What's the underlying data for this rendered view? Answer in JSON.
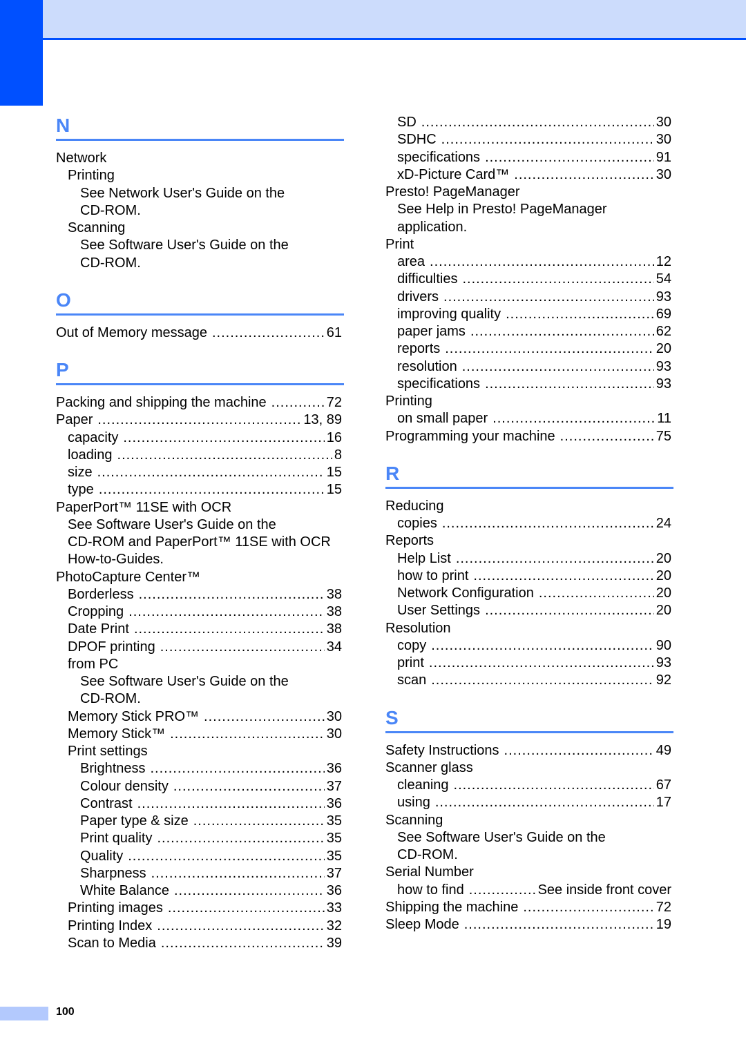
{
  "header": {
    "accent_color": "#0050ff",
    "band_color": "#ccdcfc",
    "letter_color": "#4a86f7"
  },
  "columns": [
    {
      "id": "left",
      "sections": [
        {
          "letter": "N",
          "entries": [
            {
              "level": 0,
              "term": "Network"
            },
            {
              "level": 1,
              "term": "Printing"
            },
            {
              "level": 2,
              "term": "See Network User's Guide on the"
            },
            {
              "level": 2,
              "term": "CD-ROM."
            },
            {
              "level": 1,
              "term": "Scanning"
            },
            {
              "level": 2,
              "term": "See Software User's Guide on the"
            },
            {
              "level": 2,
              "term": "CD-ROM."
            }
          ]
        },
        {
          "letter": "O",
          "entries": [
            {
              "level": 0,
              "term": "Out of Memory message",
              "page": "61"
            }
          ]
        },
        {
          "letter": "P",
          "entries": [
            {
              "level": 0,
              "term": "Packing and shipping the machine",
              "page": "72"
            },
            {
              "level": 0,
              "term": "Paper",
              "page": "13, 89"
            },
            {
              "level": 1,
              "term": "capacity",
              "page": "16"
            },
            {
              "level": 1,
              "term": "loading",
              "page": "8"
            },
            {
              "level": 1,
              "term": "size",
              "page": "15"
            },
            {
              "level": 1,
              "term": "type",
              "page": "15"
            },
            {
              "level": 0,
              "term": "PaperPort™ 11SE with OCR"
            },
            {
              "level": 1,
              "term": "See Software User's Guide on the"
            },
            {
              "level": 1,
              "term": "CD-ROM and PaperPort™ 11SE with OCR"
            },
            {
              "level": 1,
              "term": "How-to-Guides."
            },
            {
              "level": 0,
              "term": "PhotoCapture Center™"
            },
            {
              "level": 1,
              "term": "Borderless",
              "page": "38"
            },
            {
              "level": 1,
              "term": "Cropping",
              "page": "38"
            },
            {
              "level": 1,
              "term": "Date Print",
              "page": "38"
            },
            {
              "level": 1,
              "term": "DPOF printing",
              "page": "34"
            },
            {
              "level": 1,
              "term": "from PC"
            },
            {
              "level": 2,
              "term": "See Software User's Guide on the"
            },
            {
              "level": 2,
              "term": "CD-ROM."
            },
            {
              "level": 1,
              "term": "Memory Stick PRO™",
              "page": "30"
            },
            {
              "level": 1,
              "term": "Memory Stick™",
              "page": "30"
            },
            {
              "level": 1,
              "term": "Print settings"
            },
            {
              "level": 2,
              "term": "Brightness",
              "page": "36"
            },
            {
              "level": 2,
              "term": "Colour density",
              "page": "37"
            },
            {
              "level": 2,
              "term": "Contrast",
              "page": "36"
            },
            {
              "level": 2,
              "term": "Paper type & size",
              "page": "35"
            },
            {
              "level": 2,
              "term": "Print quality",
              "page": "35"
            },
            {
              "level": 2,
              "term": "Quality",
              "page": "35"
            },
            {
              "level": 2,
              "term": "Sharpness",
              "page": "37"
            },
            {
              "level": 2,
              "term": "White Balance",
              "page": "36"
            },
            {
              "level": 1,
              "term": "Printing images",
              "page": "33"
            },
            {
              "level": 1,
              "term": "Printing Index",
              "page": "32"
            },
            {
              "level": 1,
              "term": "Scan to Media",
              "page": "39"
            }
          ]
        }
      ]
    },
    {
      "id": "right",
      "sections": [
        {
          "letter": "",
          "entries": [
            {
              "level": 1,
              "term": "SD",
              "page": "30"
            },
            {
              "level": 1,
              "term": "SDHC",
              "page": "30"
            },
            {
              "level": 1,
              "term": "specifications",
              "page": "91"
            },
            {
              "level": 1,
              "term": "xD-Picture Card™",
              "page": "30"
            },
            {
              "level": 0,
              "term": "Presto! PageManager"
            },
            {
              "level": 1,
              "term": "See Help in Presto! PageManager"
            },
            {
              "level": 1,
              "term": "application."
            },
            {
              "level": 0,
              "term": "Print"
            },
            {
              "level": 1,
              "term": "area",
              "page": "12"
            },
            {
              "level": 1,
              "term": "difficulties",
              "page": "54"
            },
            {
              "level": 1,
              "term": "drivers",
              "page": "93"
            },
            {
              "level": 1,
              "term": "improving quality",
              "page": "69"
            },
            {
              "level": 1,
              "term": "paper jams",
              "page": "62"
            },
            {
              "level": 1,
              "term": "reports",
              "page": "20"
            },
            {
              "level": 1,
              "term": "resolution",
              "page": "93"
            },
            {
              "level": 1,
              "term": "specifications",
              "page": "93"
            },
            {
              "level": 0,
              "term": "Printing"
            },
            {
              "level": 1,
              "term": "on small paper",
              "page": "11"
            },
            {
              "level": 0,
              "term": "Programming your machine",
              "page": "75"
            }
          ]
        },
        {
          "letter": "R",
          "entries": [
            {
              "level": 0,
              "term": "Reducing"
            },
            {
              "level": 1,
              "term": "copies",
              "page": "24"
            },
            {
              "level": 0,
              "term": "Reports"
            },
            {
              "level": 1,
              "term": "Help List",
              "page": "20"
            },
            {
              "level": 1,
              "term": "how to print",
              "page": "20"
            },
            {
              "level": 1,
              "term": "Network Configuration",
              "page": "20"
            },
            {
              "level": 1,
              "term": "User Settings",
              "page": "20"
            },
            {
              "level": 0,
              "term": "Resolution"
            },
            {
              "level": 1,
              "term": "copy",
              "page": "90"
            },
            {
              "level": 1,
              "term": "print",
              "page": "93"
            },
            {
              "level": 1,
              "term": "scan",
              "page": "92"
            }
          ]
        },
        {
          "letter": "S",
          "entries": [
            {
              "level": 0,
              "term": "Safety Instructions",
              "page": "49"
            },
            {
              "level": 0,
              "term": "Scanner glass"
            },
            {
              "level": 1,
              "term": "cleaning",
              "page": "67"
            },
            {
              "level": 1,
              "term": "using",
              "page": "17"
            },
            {
              "level": 0,
              "term": "Scanning"
            },
            {
              "level": 1,
              "term": "See Software User's Guide on the"
            },
            {
              "level": 1,
              "term": "CD-ROM."
            },
            {
              "level": 0,
              "term": "Serial Number"
            },
            {
              "level": 1,
              "term": "how to find",
              "page": "See inside front cover"
            },
            {
              "level": 0,
              "term": "Shipping the machine",
              "page": "72"
            },
            {
              "level": 0,
              "term": "Sleep Mode",
              "page": "19"
            }
          ]
        }
      ]
    }
  ],
  "footer": {
    "page_number": "100"
  }
}
